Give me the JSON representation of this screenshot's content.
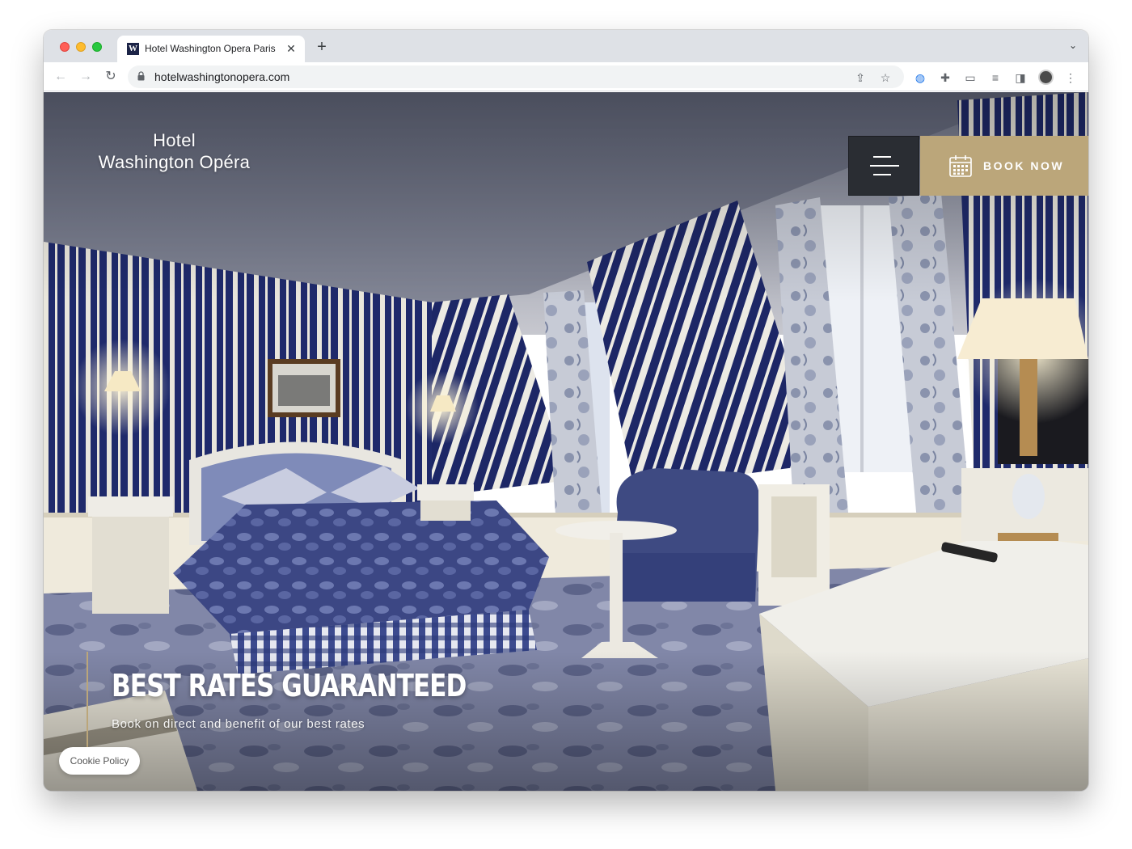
{
  "browser": {
    "tab": {
      "favicon_letter": "W",
      "title": "Hotel Washington Opera Paris",
      "close_glyph": "✕"
    },
    "new_tab_glyph": "+",
    "tab_dropdown_glyph": "⌄",
    "nav": {
      "back_glyph": "←",
      "forward_glyph": "→",
      "reload_glyph": "↻"
    },
    "url": "hotelwashingtonopera.com",
    "toolbar_icons": [
      "share-icon",
      "bookmark-star-icon",
      "password-manager-icon",
      "extensions-icon",
      "cast-icon",
      "media-queue-icon",
      "side-panel-icon",
      "profile-avatar-icon",
      "more-menu-icon"
    ],
    "toolbar_glyphs": {
      "share": "⇪",
      "star": "☆",
      "password": "◍",
      "extensions": "✚",
      "cast": "▭",
      "media": "≡",
      "sidepanel": "◨",
      "more": "⋮"
    }
  },
  "site": {
    "logo_line1": "Hotel",
    "logo_line2": "Washington Opéra",
    "book_now_label": "BOOK NOW",
    "headline": "BEST RATES GUARANTEED",
    "subline": "Book on direct and benefit of our best rates",
    "cookie_label": "Cookie Policy"
  },
  "colors": {
    "accent_gold": "#bba67a",
    "menu_dark": "#2a2d33",
    "wall_navy": "#1f2a6b"
  }
}
